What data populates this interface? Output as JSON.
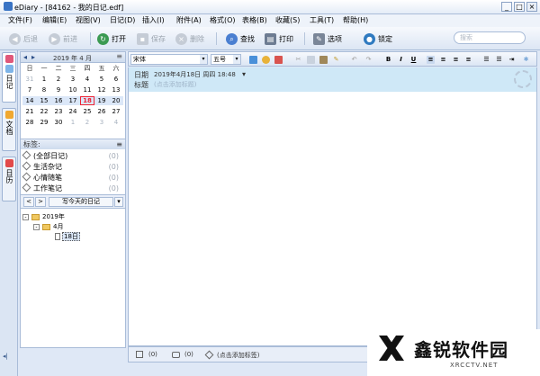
{
  "window": {
    "title": "eDiary - [84162 - 我的日记.edf]",
    "min": "_",
    "max": "□",
    "close": "×"
  },
  "menu": [
    "文件(F)",
    "编辑(E)",
    "视图(V)",
    "日记(D)",
    "插入(I)",
    "附件(A)",
    "格式(O)",
    "表格(B)",
    "收藏(S)",
    "工具(T)",
    "帮助(H)"
  ],
  "toolbar": {
    "back": "后退",
    "forward": "前进",
    "open": "打开",
    "save": "保存",
    "delete": "删除",
    "find": "查找",
    "print": "打印",
    "options": "选项",
    "lock": "锁定",
    "search_placeholder": "搜索"
  },
  "left_tabs": [
    "日记",
    "文档",
    "日历"
  ],
  "calendar": {
    "title": "2019 年 4 月",
    "prev": "◂",
    "next": "▸",
    "weekdays": [
      "日",
      "一",
      "二",
      "三",
      "四",
      "五",
      "六"
    ],
    "weeks": [
      [
        "31",
        "1",
        "2",
        "3",
        "4",
        "5",
        "6"
      ],
      [
        "7",
        "8",
        "9",
        "10",
        "11",
        "12",
        "13"
      ],
      [
        "14",
        "15",
        "16",
        "17",
        "18",
        "19",
        "20"
      ],
      [
        "21",
        "22",
        "23",
        "24",
        "25",
        "26",
        "27"
      ],
      [
        "28",
        "29",
        "30",
        "1",
        "2",
        "3",
        "4"
      ]
    ],
    "today": "18"
  },
  "tags": {
    "header": "标签:",
    "items": [
      {
        "label": "(全部日记)",
        "count": "(0)"
      },
      {
        "label": "生活杂记",
        "count": "(0)"
      },
      {
        "label": "心情随笔",
        "count": "(0)"
      },
      {
        "label": "工作笔记",
        "count": "(0)"
      }
    ]
  },
  "nav": {
    "prev": "<",
    "next": ">",
    "today_button": "写今天的日记",
    "dropdown": "▾"
  },
  "tree": {
    "year": "2019年",
    "month": "4月",
    "day": "18日",
    "expander": "-"
  },
  "editor": {
    "font": "宋体",
    "size": "五号",
    "date_label": "日期",
    "date_value": "2019年4月18日 周四 18:48",
    "date_arrow": "▾",
    "title_label": "标题",
    "title_placeholder": "(点击添加标题)"
  },
  "status": {
    "attach": "(0)",
    "comments": "(0)",
    "tags_placeholder": "(点击添加标签)"
  },
  "watermark": {
    "brand": "鑫锐软件园",
    "url": "XRCCTV.NET"
  },
  "collapse": "◂|"
}
